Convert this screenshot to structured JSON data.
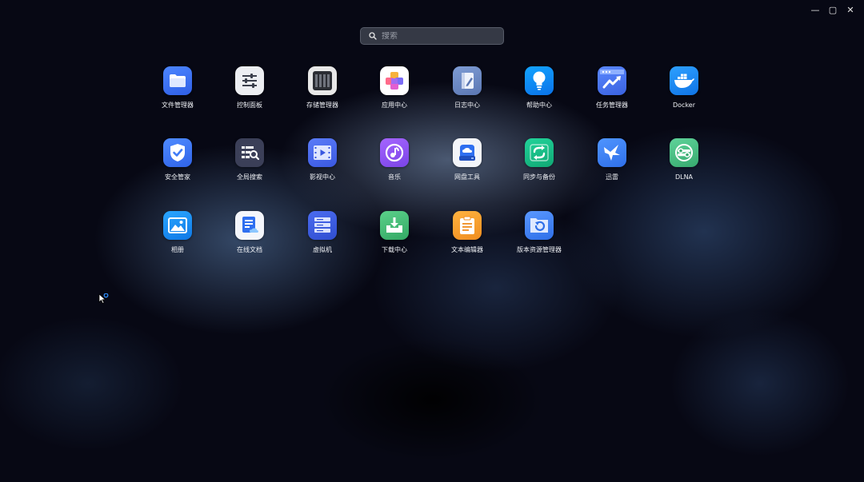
{
  "search": {
    "placeholder": "搜索"
  },
  "window_controls": {
    "minimize": "—",
    "maximize": "▢",
    "close": "✕"
  },
  "apps": [
    {
      "label": "文件管理器",
      "icon": "folder-icon",
      "color": "#3d76f5"
    },
    {
      "label": "控制面板",
      "icon": "sliders-icon",
      "color": "#e9ebef"
    },
    {
      "label": "存储管理器",
      "icon": "drive-bays-icon",
      "color": "#e6e6e6"
    },
    {
      "label": "应用中心",
      "icon": "app-cube-icon",
      "color": "#ffffff"
    },
    {
      "label": "日志中心",
      "icon": "log-book-icon",
      "color": "#6f8fc9"
    },
    {
      "label": "帮助中心",
      "icon": "lightbulb-icon",
      "color": "#0a8cff"
    },
    {
      "label": "任务管理器",
      "icon": "trend-chart-icon",
      "color": "#4b78f2"
    },
    {
      "label": "Docker",
      "icon": "docker-whale-icon",
      "color": "#1d8cf5"
    },
    {
      "label": "安全管家",
      "icon": "shield-check-icon",
      "color": "#3f7bf6"
    },
    {
      "label": "全局搜索",
      "icon": "search-list-icon",
      "color": "#3a3f5a"
    },
    {
      "label": "影视中心",
      "icon": "film-play-icon",
      "color": "#4a6cf0"
    },
    {
      "label": "音乐",
      "icon": "music-note-icon",
      "color": "#8e55ee"
    },
    {
      "label": "网盘工具",
      "icon": "cloud-drive-icon",
      "color": "#f2f4f8"
    },
    {
      "label": "同步与备份",
      "icon": "sync-icon",
      "color": "#18c38a"
    },
    {
      "label": "迅雷",
      "icon": "thunder-bird-icon",
      "color": "#3f86f5"
    },
    {
      "label": "DLNA",
      "icon": "dlna-icon",
      "color": "#4fc48a"
    },
    {
      "label": "相册",
      "icon": "photo-icon",
      "color": "#1b8ef0"
    },
    {
      "label": "在线文档",
      "icon": "online-doc-icon",
      "color": "#f3f5fa"
    },
    {
      "label": "虚拟机",
      "icon": "server-icon",
      "color": "#3f5fd8"
    },
    {
      "label": "下载中心",
      "icon": "download-tray-icon",
      "color": "#4cc07a"
    },
    {
      "label": "文本编辑器",
      "icon": "clipboard-icon",
      "color": "#f7a531"
    },
    {
      "label": "版本资源管理器",
      "icon": "version-folder-icon",
      "color": "#3f86f5"
    }
  ]
}
